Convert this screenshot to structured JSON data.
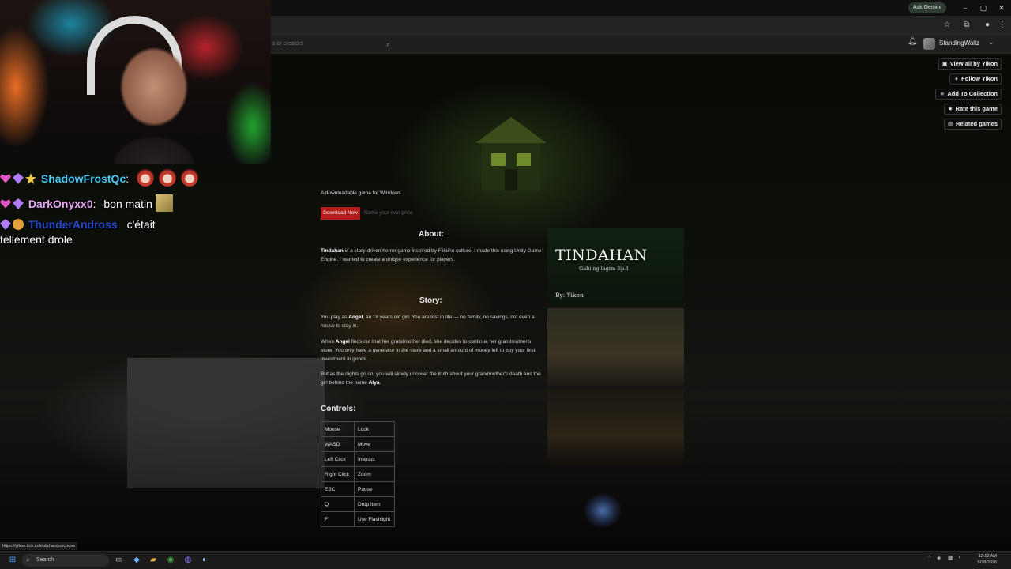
{
  "browser": {
    "ask_gemini": "Ask Gemini",
    "minimize": "–",
    "maximize": "▢",
    "close": "✕",
    "search_placeholder": "s or creators",
    "status_url": "https://yikon.itch.io/tindahan/purchase"
  },
  "itch_header": {
    "username": "StandingWaltz"
  },
  "sidebar": {
    "buttons": [
      {
        "label": "View all by Yikon",
        "icon": "▣"
      },
      {
        "label": "Follow Yikon",
        "icon": "+"
      },
      {
        "label": "Add To Collection",
        "icon": "≡"
      },
      {
        "label": "Rate this game",
        "icon": "★"
      },
      {
        "label": "Related games",
        "icon": "▥"
      }
    ]
  },
  "game": {
    "platform_line": "A downloadable game for Windows",
    "download_label": "Download Now",
    "price_label": "Name your own price",
    "about_heading": "About:",
    "about_name": "Tindahan",
    "about_text": " is a story-driven horror game inspired by Filipino culture. I made this using Unity Game Engine. I wanted to create a unique experience for players.",
    "story_heading": "Story:",
    "story_p1_pre": "You play as ",
    "story_p1_name": "Angel",
    "story_p1_post": ", an 18 years old girl. You are lost in life — no family, no savings, not even a house to stay in.",
    "story_p2_pre": "When ",
    "story_p2_name": "Angel",
    "story_p2_post": " finds out that her grandmother died, she decides to continue her grandmother's store. You only have a generator in the store and a small amount of money left to buy your first investment in goods.",
    "story_p3_pre": "But as the nights go on, you will slowly uncover the truth about your grandmother's death and the girl behind the name ",
    "story_p3_name": "Alya",
    "story_p3_post": ".",
    "controls_heading": "Controls:",
    "controls": [
      {
        "key": "Mouse",
        "action": "Look"
      },
      {
        "key": "WASD",
        "action": "Move"
      },
      {
        "key": "Left Click",
        "action": "Interact"
      },
      {
        "key": "Right Click",
        "action": "Zoom"
      },
      {
        "key": "ESC",
        "action": "Pause"
      },
      {
        "key": "Q",
        "action": "Drop Item"
      },
      {
        "key": "F",
        "action": "Use Flashlight"
      }
    ],
    "cover_title": "TINDAHAN",
    "cover_subtitle": "Gabi ng lagim Ep.1",
    "cover_by": "By: Yikon"
  },
  "chat": [
    {
      "user": "ShadowFrostQc",
      "sep": ":",
      "color": "#47c8f0",
      "message": ""
    },
    {
      "user": "DarkOnyxx0",
      "sep": ":",
      "color": "#e8a6f5",
      "message": "bon matin"
    },
    {
      "user": "ThunderAndross",
      "sep": "",
      "color": "#2447c7",
      "message": "c'était"
    },
    {
      "user": "",
      "sep": "",
      "color": "#ffffff",
      "message": "tellement drole"
    }
  ],
  "taskbar": {
    "search_label": "Search",
    "time": "12:12 AM",
    "date": "8/28/2026"
  }
}
